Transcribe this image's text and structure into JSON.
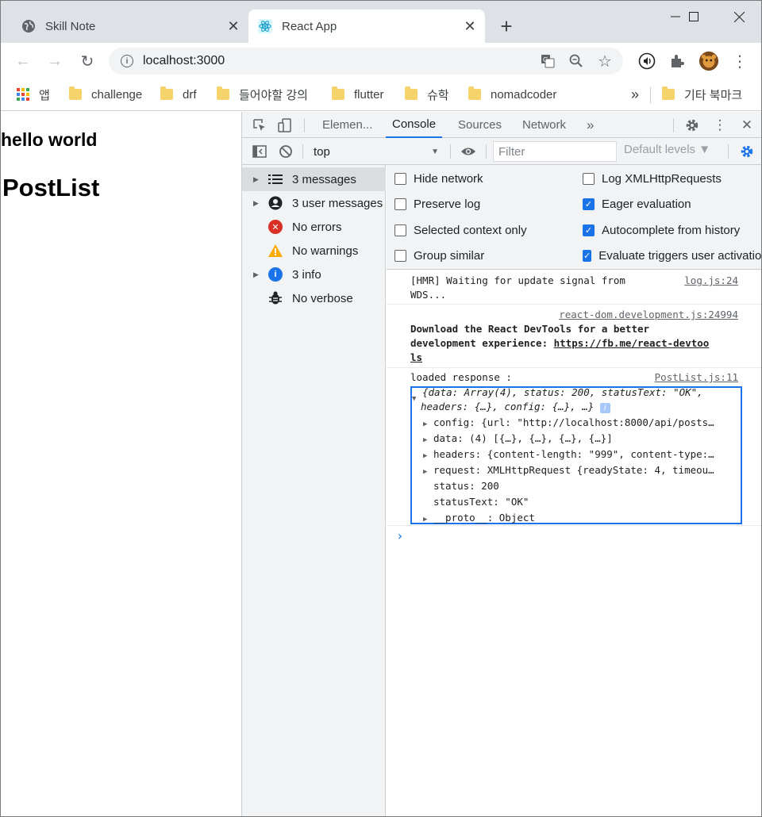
{
  "browser": {
    "tabs": [
      {
        "title": "Skill Note",
        "active": false
      },
      {
        "title": "React App",
        "active": true
      }
    ],
    "new_tab": "+",
    "address": "localhost:3000",
    "bookmarks": [
      "앱",
      "challenge",
      "drf",
      "들어야할 강의",
      "flutter",
      "슈학",
      "nomadcoder"
    ],
    "bookmarks_overflow": "»",
    "other_bookmarks": "기타 북마크"
  },
  "page": {
    "heading": "hello world",
    "title": "PostList"
  },
  "devtools": {
    "tabs": [
      "Elemen...",
      "Console",
      "Sources",
      "Network"
    ],
    "more": "»",
    "context": "top",
    "filter_placeholder": "Filter",
    "levels": "Default levels ▼",
    "sidebar": [
      {
        "label": "3 messages",
        "icon": "list-icon",
        "expandable": true
      },
      {
        "label": "3 user messages",
        "icon": "user-icon",
        "expandable": true
      },
      {
        "label": "No errors",
        "icon": "error-icon",
        "expandable": false
      },
      {
        "label": "No warnings",
        "icon": "warning-icon",
        "expandable": false
      },
      {
        "label": "3 info",
        "icon": "info-icon",
        "expandable": true
      },
      {
        "label": "No verbose",
        "icon": "bug-icon",
        "expandable": false
      }
    ],
    "settings": [
      {
        "label": "Hide network",
        "checked": false
      },
      {
        "label": "Preserve log",
        "checked": false
      },
      {
        "label": "Selected context only",
        "checked": false
      },
      {
        "label": "Group similar",
        "checked": false
      },
      {
        "label": "Log XMLHttpRequests",
        "checked": false
      },
      {
        "label": "Eager evaluation",
        "checked": true
      },
      {
        "label": "Autocomplete from history",
        "checked": true
      },
      {
        "label": "Evaluate triggers user activation",
        "checked": true
      }
    ],
    "console": {
      "msg1": {
        "text": "[HMR] Waiting for update signal from\nWDS...",
        "source": "log.js:24"
      },
      "msg2": {
        "source": "react-dom.development.js:24994",
        "text_bold": "Download the React DevTools for a better\ndevelopment experience: ",
        "link": "https://fb.me/react-devtoo\nls"
      },
      "msg3": {
        "label": "loaded response :",
        "source": "PostList.js:11"
      },
      "object": {
        "summary_1": "{data: Array(4), status: 200, statusText: \"OK\",",
        "summary_2": "headers: {…}, config: {…}, …}",
        "config": "config: {url: \"http://localhost:8000/api/posts…",
        "data": "data: (4) [{…}, {…}, {…}, {…}]",
        "headers": "headers: {content-length: \"999\", content-type:…",
        "request": "request: XMLHttpRequest {readyState: 4, timeou…",
        "status": "status: 200",
        "statusText": "statusText: \"OK\"",
        "proto": "__proto__: Object"
      }
    }
  }
}
